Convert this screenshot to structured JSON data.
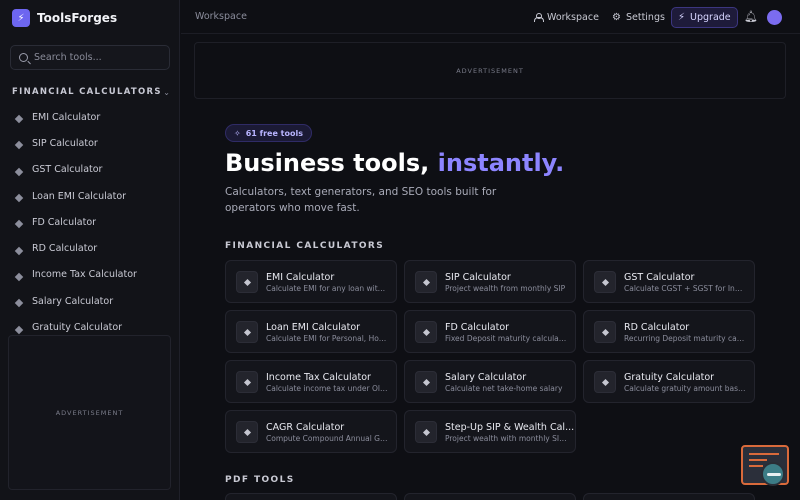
{
  "brand": {
    "name": "ToolsForges",
    "logo_glyph": "⚡"
  },
  "search": {
    "placeholder": "Search tools..."
  },
  "sidebar": {
    "section_title": "FINANCIAL CALCULATORS",
    "items": [
      {
        "label": "EMI Calculator"
      },
      {
        "label": "SIP Calculator"
      },
      {
        "label": "GST Calculator"
      },
      {
        "label": "Loan EMI Calculator"
      },
      {
        "label": "FD Calculator"
      },
      {
        "label": "RD Calculator"
      },
      {
        "label": "Income Tax Calculator"
      },
      {
        "label": "Salary Calculator"
      },
      {
        "label": "Gratuity Calculator"
      }
    ],
    "ad_label": "ADVERTISEMENT"
  },
  "header": {
    "breadcrumb": "Workspace",
    "workspace_label": "Workspace",
    "settings_label": "Settings",
    "upgrade_label": "Upgrade"
  },
  "main": {
    "ad_label": "ADVERTISEMENT",
    "badge": "61 free tools",
    "hero_title_plain": "Business tools, ",
    "hero_title_accent": "instantly.",
    "hero_subtitle": "Calculators, text generators, and SEO tools built for operators who move fast.",
    "financial_section_title": "FINANCIAL CALCULATORS",
    "cards": [
      {
        "title": "EMI Calculator",
        "desc": "Calculate EMI for any loan with interest"
      },
      {
        "title": "SIP Calculator",
        "desc": "Project wealth from monthly SIP"
      },
      {
        "title": "GST Calculator",
        "desc": "Calculate CGST + SGST for India"
      },
      {
        "title": "Loan EMI Calculator",
        "desc": "Calculate EMI for Personal, Home loans"
      },
      {
        "title": "FD Calculator",
        "desc": "Fixed Deposit maturity calculator"
      },
      {
        "title": "RD Calculator",
        "desc": "Recurring Deposit maturity calculator"
      },
      {
        "title": "Income Tax Calculator",
        "desc": "Calculate income tax under Old and New"
      },
      {
        "title": "Salary Calculator",
        "desc": "Calculate net take-home salary"
      },
      {
        "title": "Gratuity Calculator",
        "desc": "Calculate gratuity amount based on tenure"
      },
      {
        "title": "CAGR Calculator",
        "desc": "Compute Compound Annual Growth Rate"
      },
      {
        "title": "Step-Up SIP & Wealth Cal...",
        "desc": "Project wealth with monthly SIP step-up"
      }
    ],
    "pdf_section_title": "PDF TOOLS"
  },
  "colors": {
    "accent": "#8d85ff",
    "background": "#0e0f14",
    "upgrade_bg": "#1e1b3a"
  }
}
